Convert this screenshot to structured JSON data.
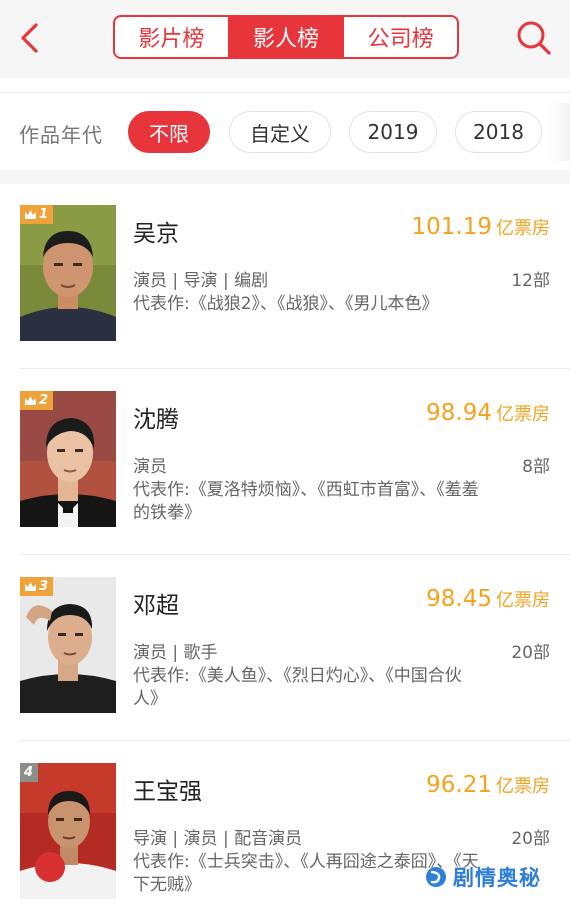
{
  "header": {
    "tabs": [
      {
        "label": "影片榜",
        "active": false
      },
      {
        "label": "影人榜",
        "active": true
      },
      {
        "label": "公司榜",
        "active": false
      }
    ],
    "back_icon": "chevron-left-icon",
    "search_icon": "search-icon"
  },
  "filter": {
    "label": "作品年代",
    "chips": [
      {
        "label": "不限",
        "active": true
      },
      {
        "label": "自定义",
        "active": false
      },
      {
        "label": "2019",
        "active": false
      },
      {
        "label": "2018",
        "active": false
      }
    ]
  },
  "list": {
    "unit": "亿票房",
    "items": [
      {
        "rank": "1",
        "name": "吴京",
        "box_office": "101.19",
        "roles": "演员 | 导演 | 编剧",
        "count": "12部",
        "works": "代表作:《战狼2》、《战狼》、《男儿本色》"
      },
      {
        "rank": "2",
        "name": "沈腾",
        "box_office": "98.94",
        "roles": "演员",
        "count": "8部",
        "works": "代表作:《夏洛特烦恼》、《西虹市首富》、《羞羞的铁拳》"
      },
      {
        "rank": "3",
        "name": "邓超",
        "box_office": "98.45",
        "roles": "演员 | 歌手",
        "count": "20部",
        "works": "代表作:《美人鱼》、《烈日灼心》、《中国合伙人》"
      },
      {
        "rank": "4",
        "name": "王宝强",
        "box_office": "96.21",
        "roles": "导演 | 演员 | 配音演员",
        "count": "20部",
        "works": "代表作:《士兵突击》、《人再囧途之泰囧》、《天下无贼》"
      }
    ]
  },
  "watermark": {
    "text": "剧情奥秘"
  },
  "colors": {
    "accent": "#e8343b",
    "box_office": "#f5a21f",
    "badge_top": "#f0a23a",
    "badge_plain": "#8d8d8d"
  }
}
